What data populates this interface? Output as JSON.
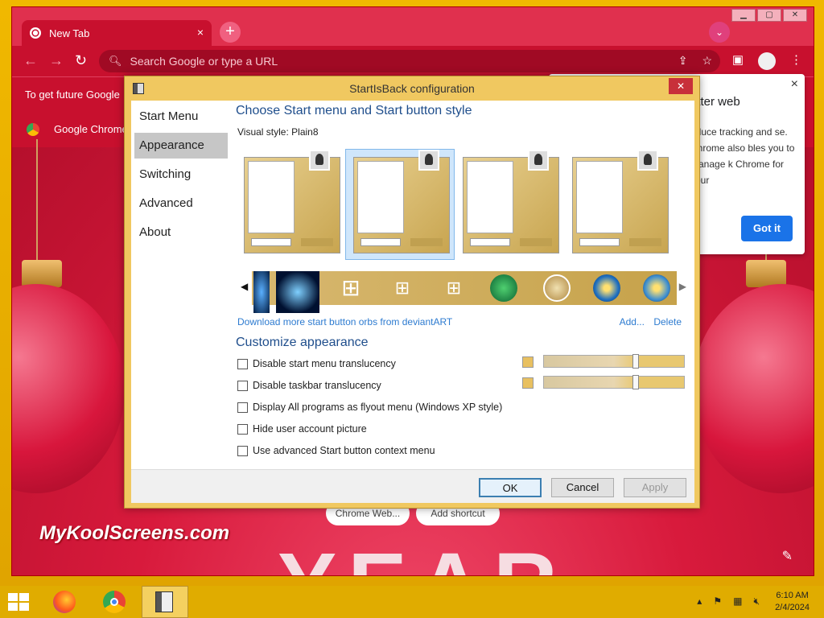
{
  "browser": {
    "tab_title": "New Tab",
    "tab_close": "×",
    "new_tab": "+",
    "omnibox_placeholder": "Search Google or type a URL",
    "infobar_text": "To get future Google",
    "bookmark_label": "Google Chrome"
  },
  "popover": {
    "title": "etter web",
    "body": "educe tracking and se. Chrome also bles you to manage k Chrome for your",
    "button": "Got it",
    "close": "×"
  },
  "ntp": {
    "shortcut_1": "Chrome Web...",
    "shortcut_2": "Add shortcut",
    "brand": "MyKoolScreens.com",
    "year": "YEAR"
  },
  "dialog": {
    "title": "StartIsBack configuration",
    "close": "✕",
    "sidebar": [
      {
        "label": "Start Menu"
      },
      {
        "label": "Appearance"
      },
      {
        "label": "Switching"
      },
      {
        "label": "Advanced"
      },
      {
        "label": "About"
      }
    ],
    "heading_style": "Choose Start menu and Start button style",
    "visual_style_label": "Visual style:",
    "visual_style_value": "Plain8",
    "download_link": "Download more start button orbs from deviantART",
    "add_link": "Add...",
    "delete_link": "Delete",
    "heading_customize": "Customize appearance",
    "options": [
      {
        "label": "Disable start menu translucency",
        "checked": false
      },
      {
        "label": "Disable taskbar translucency",
        "checked": false
      },
      {
        "label": "Display All programs as flyout menu (Windows XP style)",
        "checked": false
      },
      {
        "label": "Hide user account picture",
        "checked": false
      },
      {
        "label": "Use advanced Start button context menu",
        "checked": false
      }
    ],
    "buttons": {
      "ok": "OK",
      "cancel": "Cancel",
      "apply": "Apply"
    }
  },
  "taskbar": {
    "time": "6:10 AM",
    "date": "2/4/2024"
  },
  "colors": {
    "accent": "#c8102e",
    "dialog_frame": "#f0c860",
    "taskbar": "#e0ac00",
    "link": "#2d7bd0",
    "heading": "#1f4e8c"
  }
}
